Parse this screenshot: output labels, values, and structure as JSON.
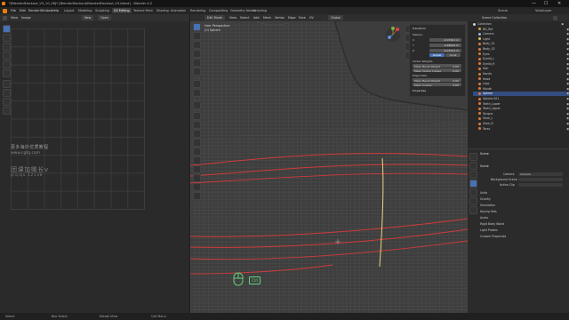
{
  "window": {
    "title": "*[BlenderBlockout_V3_10_08]* [BlenderBlockout/BlenderBlockout_V3.blend] - Blender 4.2",
    "controls": {
      "minimize": "—",
      "maximize": "☐",
      "close": "✕"
    }
  },
  "menu": {
    "items": [
      "File",
      "Edit",
      "Render",
      "Window",
      "Help"
    ],
    "workspaces": [
      "Layout",
      "Modeling",
      "Sculpting",
      "UV Editing",
      "Texture Paint",
      "Shading",
      "Animation",
      "Rendering",
      "Compositing",
      "Geometry Nodes",
      "Scripting"
    ],
    "active_workspace": "UV Editing",
    "scene": "Scene",
    "view_layer": "ViewLayer"
  },
  "uv_editor": {
    "header": {
      "view": "View",
      "image": "Image",
      "new_button": "New",
      "open_button": "Open"
    },
    "watermark": {
      "line1": "更多海外优质教程",
      "line2": "www.cgtq.com",
      "line3": "团课加微长v",
      "line4": "qiqiqu 12138"
    }
  },
  "viewport": {
    "header": {
      "mode": "Edit Mode",
      "view": "View",
      "select": "Select",
      "add": "Add",
      "mesh": "Mesh",
      "vertex": "Vertex",
      "edge": "Edge",
      "face": "Face",
      "uv": "UV",
      "global": "Global"
    },
    "info": {
      "line1": "User Perspective",
      "line2": "(0) Sphere"
    },
    "overlay_badge": "Ctrl",
    "colors": {
      "seam": "#d23a3a",
      "selected_edge": "#e8d27a",
      "wire": "#6a6a6a"
    }
  },
  "n_panel": {
    "sections": [
      "Transform",
      "Properties"
    ],
    "median_label": "Median:",
    "rows": [
      {
        "label": "X",
        "value": "-0.07401 m"
      },
      {
        "label": "Y",
        "value": "0.28942 m"
      },
      {
        "label": "Z",
        "value": "-0.07554 m"
      }
    ],
    "toggle_global": "Global",
    "toggle_local": "Local",
    "vertex_weights": {
      "label": "Vertex Weights",
      "bevel": "Mean Bevel Weight",
      "bevel_value": "0.00"
    },
    "crease": {
      "label": "Mean Vertex Crease",
      "value": "0.00"
    },
    "edge_data": "Edge Data:",
    "edge_bevel": {
      "label": "Mean Bevel Weight",
      "value": "0.00"
    },
    "edge_crease": {
      "label": "Mean Crease",
      "value": "0.00"
    }
  },
  "outliner": {
    "header": "Scene Collection",
    "items": [
      {
        "name": "Collection",
        "color": "#cfcfcf"
      },
      {
        "name": "BG_Ref",
        "color": "#d6a043"
      },
      {
        "name": "Camera",
        "color": "#9bb7e5"
      },
      {
        "name": "Light",
        "color": "#e0c060"
      },
      {
        "name": "Body_01",
        "color": "#e07a3a"
      },
      {
        "name": "Body_02",
        "color": "#e07a3a"
      },
      {
        "name": "Eyes",
        "color": "#e07a3a"
      },
      {
        "name": "Eyelid_L",
        "color": "#e07a3a"
      },
      {
        "name": "Eyelid_R",
        "color": "#e07a3a"
      },
      {
        "name": "Hair",
        "color": "#e07a3a"
      },
      {
        "name": "Hands",
        "color": "#e07a3a"
      },
      {
        "name": "Head",
        "color": "#e07a3a"
      },
      {
        "name": "Legs",
        "color": "#e07a3a"
      },
      {
        "name": "Mouth",
        "color": "#e07a3a"
      },
      {
        "name": "Sphere",
        "color": "#e07a3a"
      },
      {
        "name": "Sphere.001",
        "color": "#e07a3a"
      },
      {
        "name": "Teeth_Lower",
        "color": "#e07a3a"
      },
      {
        "name": "Teeth_Upper",
        "color": "#e07a3a"
      },
      {
        "name": "Tongue",
        "color": "#e07a3a"
      },
      {
        "name": "Shoe_L",
        "color": "#e07a3a"
      },
      {
        "name": "Shoe_R",
        "color": "#e07a3a"
      },
      {
        "name": "Torso",
        "color": "#e07a3a"
      }
    ],
    "selected_index": 14
  },
  "properties": {
    "title": "Scene",
    "section_scene": "Scene",
    "camera_label": "Camera",
    "camera_value": "Camera",
    "background_scene_label": "Background Scene",
    "active_clip_label": "Active Clip",
    "units": "Units",
    "gravity": "Gravity",
    "simulation": "Simulation",
    "keying_sets": "Keying Sets",
    "audio": "Audio",
    "rigid_body_world": "Rigid Body World",
    "light_probes": "Light Probes",
    "custom_properties": "Custom Properties"
  },
  "statusbar": {
    "left": "Select",
    "middle": "Box Select",
    "right": "Rotate View",
    "far": "Call Menu"
  }
}
